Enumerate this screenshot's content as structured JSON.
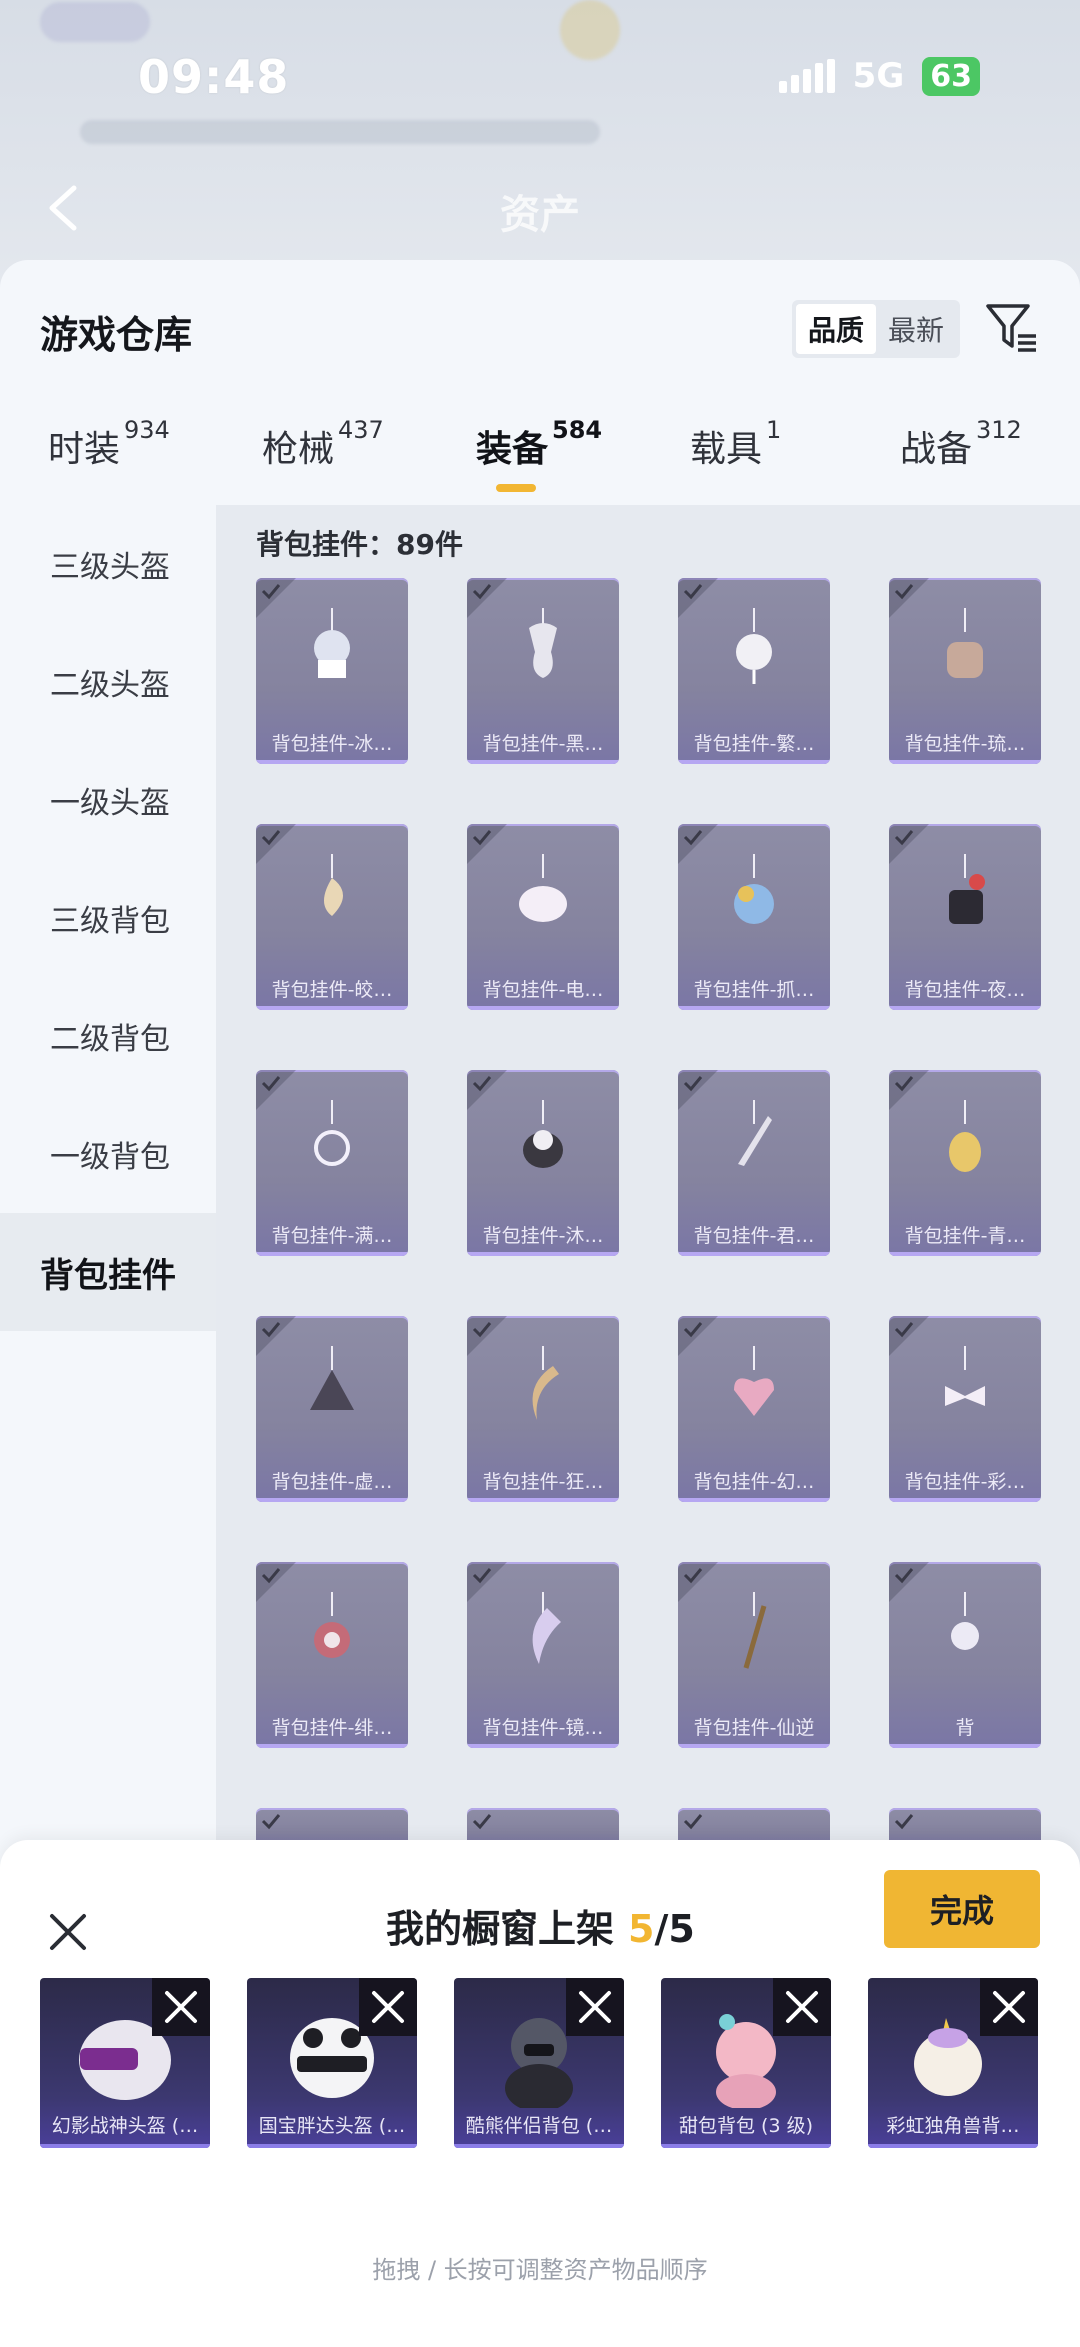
{
  "status": {
    "time": "09:48",
    "network": "5G",
    "battery": "63"
  },
  "background_header": {
    "title": "资产"
  },
  "panel": {
    "title": "游戏仓库",
    "sort": {
      "quality": "品质",
      "latest": "最新"
    }
  },
  "tabs": [
    {
      "label": "时装",
      "count": "934"
    },
    {
      "label": "枪械",
      "count": "437"
    },
    {
      "label": "装备",
      "count": "584"
    },
    {
      "label": "载具",
      "count": "1"
    },
    {
      "label": "战备",
      "count": "312"
    }
  ],
  "categories": [
    "三级头盔",
    "二级头盔",
    "一级头盔",
    "三级背包",
    "二级背包",
    "一级背包",
    "背包挂件"
  ],
  "content": {
    "count_label": "背包挂件：89件",
    "items": [
      "背包挂件-冰…",
      "背包挂件-黑…",
      "背包挂件-繁…",
      "背包挂件-琉…",
      "背包挂件-皎…",
      "背包挂件-电…",
      "背包挂件-抓…",
      "背包挂件-夜…",
      "背包挂件-满…",
      "背包挂件-沐…",
      "背包挂件-君…",
      "背包挂件-青…",
      "背包挂件-虚…",
      "背包挂件-狂…",
      "背包挂件-幻…",
      "背包挂件-彩…",
      "背包挂件-绯…",
      "背包挂件-镜…",
      "背包挂件-仙逆",
      "背"
    ]
  },
  "showcase": {
    "title": "我的橱窗上架",
    "current": "5",
    "total": "/5",
    "done_label": "完成",
    "slots": [
      "幻影战神头盔 (…",
      "国宝胖达头盔 (…",
      "酷熊伴侣背包 (…",
      "甜包背包 (3 级)",
      "彩虹独角兽背…"
    ],
    "hint": "拖拽 / 长按可调整资产物品顺序"
  },
  "colors": {
    "accent": "#f2b632",
    "card": "#85839f",
    "card_bottom": "#b6a7f2",
    "slot_bg": "#3c3870"
  }
}
